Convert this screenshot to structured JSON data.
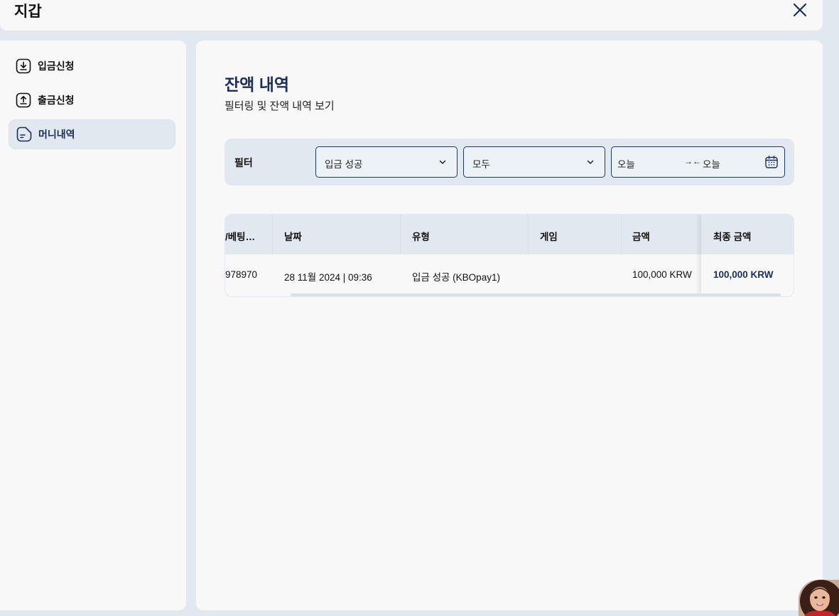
{
  "window": {
    "title": "지갑"
  },
  "sidebar": {
    "items": [
      {
        "label": "입금신청",
        "icon": "download-icon",
        "active": false
      },
      {
        "label": "출금신청",
        "icon": "upload-icon",
        "active": false
      },
      {
        "label": "머니내역",
        "icon": "document-icon",
        "active": true
      }
    ]
  },
  "main": {
    "title": "잔액 내역",
    "subtitle": "필터링 및 잔액 내역 보기",
    "filter": {
      "label": "필터",
      "type_select": "입금 성공",
      "game_select": "모두",
      "date_from": "오늘",
      "date_to": "오늘"
    },
    "table": {
      "headers": [
        "/베팅…",
        "날짜",
        "유형",
        "게임",
        "금액",
        "최종 금액"
      ],
      "rows": [
        {
          "id": "978970",
          "date": "28 11월 2024 | 09:36",
          "type": "입금 성공 (KBOpay1)",
          "game": "",
          "amount": "100,000 KRW",
          "final_amount": "100,000 KRW"
        }
      ]
    }
  },
  "colors": {
    "accent": "#1b2e59",
    "panel": "#f8f8f8",
    "background": "#e1e8f0"
  }
}
